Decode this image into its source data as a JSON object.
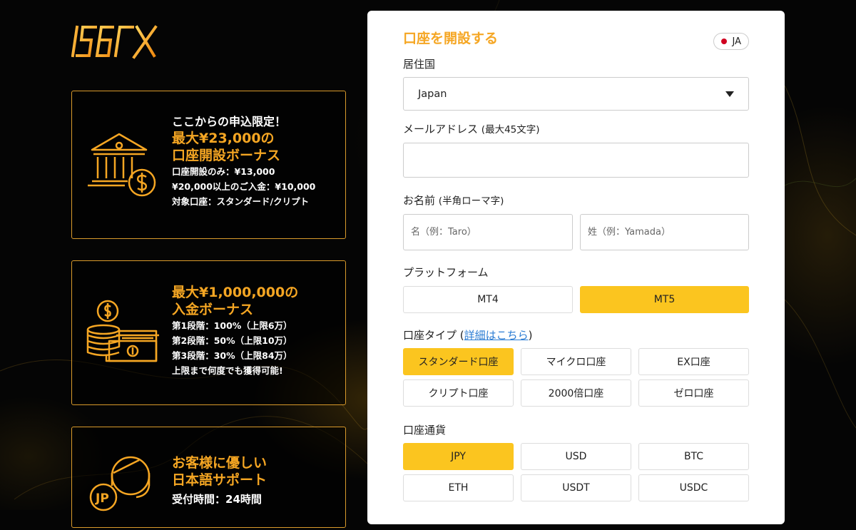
{
  "brand": {
    "logo_text": "IS6FX",
    "accent": "#f5a623",
    "highlight": "#fbc51f"
  },
  "promos": [
    {
      "icon": "bank-coin-icon",
      "lead": "ここからの申込限定！",
      "headline": [
        "最大¥23,000の",
        "口座開設ボーナス"
      ],
      "lines": [
        "口座開設のみ：¥13,000",
        "¥20,000以上のご入金：¥10,000",
        "対象口座：スタンダード/クリプト"
      ]
    },
    {
      "icon": "coins-cash-icon",
      "headline": [
        "最大¥1,000,000の",
        "入金ボーナス"
      ],
      "lines": [
        "第1段階：100%（上限6万）",
        "第2段階：50%（上限10万）",
        "第3段階：30%（上限84万）",
        "上限まで何度でも獲得可能!"
      ]
    },
    {
      "icon": "support-agent-icon",
      "icon_badge": "JP",
      "headline": [
        "お客様に優しい",
        "日本語サポート"
      ],
      "lines": [
        "受付時間：24時間"
      ]
    }
  ],
  "form": {
    "title": "口座を開設する",
    "language": "JA",
    "country": {
      "label": "居住国",
      "value": "Japan"
    },
    "email": {
      "label": "メールアドレス",
      "hint": "(最大45文字)",
      "value": ""
    },
    "name": {
      "label": "お名前",
      "hint": "(半角ローマ字)",
      "first_placeholder": "名（例：Taro）",
      "last_placeholder": "姓（例：Yamada）"
    },
    "platform": {
      "label": "プラットフォーム",
      "options": [
        "MT4",
        "MT5"
      ],
      "selected": "MT5"
    },
    "account_type": {
      "label": "口座タイプ",
      "link_open": "(",
      "link": "詳細はこちら",
      "link_close": ")",
      "options": [
        "スタンダード口座",
        "マイクロ口座",
        "EX口座",
        "クリプト口座",
        "2000倍口座",
        "ゼロ口座"
      ],
      "selected": "スタンダード口座"
    },
    "currency": {
      "label": "口座通貨",
      "options": [
        "JPY",
        "USD",
        "BTC",
        "ETH",
        "USDT",
        "USDC"
      ],
      "selected": "JPY"
    }
  }
}
